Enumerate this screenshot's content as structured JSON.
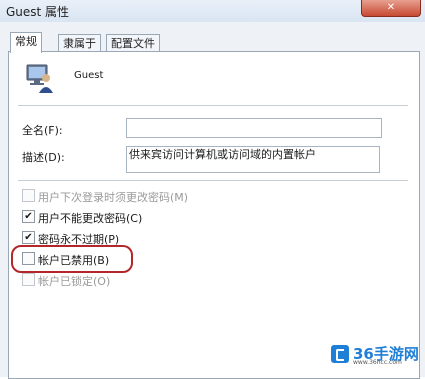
{
  "window": {
    "title": "Guest 属性",
    "close_label": "✕"
  },
  "tabs": [
    {
      "label": "常规",
      "active": true
    },
    {
      "label": "隶属于",
      "active": false
    },
    {
      "label": "配置文件",
      "active": false
    }
  ],
  "user": {
    "name": "Guest",
    "icon": "user-computer-icon"
  },
  "fields": {
    "full_name": {
      "label": "全名(F):",
      "value": ""
    },
    "description": {
      "label": "描述(D):",
      "value": "供来宾访问计算机或访问域的内置帐户"
    }
  },
  "options": [
    {
      "label": "用户下次登录时须更改密码(M)",
      "checked": false,
      "enabled": false
    },
    {
      "label": "用户不能更改密码(C)",
      "checked": true,
      "enabled": true
    },
    {
      "label": "密码永不过期(P)",
      "checked": true,
      "enabled": true
    },
    {
      "label": "帐户已禁用(B)",
      "checked": false,
      "enabled": true
    },
    {
      "label": "帐户已锁定(O)",
      "checked": false,
      "enabled": false
    }
  ],
  "watermark": {
    "brand": "36手游网",
    "url": "www.36hcc.com",
    "color": "#1f7fd6"
  },
  "colors": {
    "highlight": "#b3262a"
  }
}
